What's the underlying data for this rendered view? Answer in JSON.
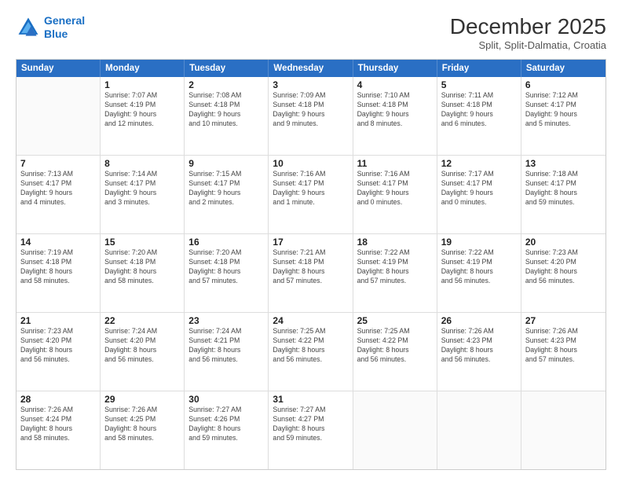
{
  "header": {
    "logo_line1": "General",
    "logo_line2": "Blue",
    "month": "December 2025",
    "location": "Split, Split-Dalmatia, Croatia"
  },
  "days_of_week": [
    "Sunday",
    "Monday",
    "Tuesday",
    "Wednesday",
    "Thursday",
    "Friday",
    "Saturday"
  ],
  "weeks": [
    [
      {
        "day": "",
        "info": ""
      },
      {
        "day": "1",
        "info": "Sunrise: 7:07 AM\nSunset: 4:19 PM\nDaylight: 9 hours\nand 12 minutes."
      },
      {
        "day": "2",
        "info": "Sunrise: 7:08 AM\nSunset: 4:18 PM\nDaylight: 9 hours\nand 10 minutes."
      },
      {
        "day": "3",
        "info": "Sunrise: 7:09 AM\nSunset: 4:18 PM\nDaylight: 9 hours\nand 9 minutes."
      },
      {
        "day": "4",
        "info": "Sunrise: 7:10 AM\nSunset: 4:18 PM\nDaylight: 9 hours\nand 8 minutes."
      },
      {
        "day": "5",
        "info": "Sunrise: 7:11 AM\nSunset: 4:18 PM\nDaylight: 9 hours\nand 6 minutes."
      },
      {
        "day": "6",
        "info": "Sunrise: 7:12 AM\nSunset: 4:17 PM\nDaylight: 9 hours\nand 5 minutes."
      }
    ],
    [
      {
        "day": "7",
        "info": "Sunrise: 7:13 AM\nSunset: 4:17 PM\nDaylight: 9 hours\nand 4 minutes."
      },
      {
        "day": "8",
        "info": "Sunrise: 7:14 AM\nSunset: 4:17 PM\nDaylight: 9 hours\nand 3 minutes."
      },
      {
        "day": "9",
        "info": "Sunrise: 7:15 AM\nSunset: 4:17 PM\nDaylight: 9 hours\nand 2 minutes."
      },
      {
        "day": "10",
        "info": "Sunrise: 7:16 AM\nSunset: 4:17 PM\nDaylight: 9 hours\nand 1 minute."
      },
      {
        "day": "11",
        "info": "Sunrise: 7:16 AM\nSunset: 4:17 PM\nDaylight: 9 hours\nand 0 minutes."
      },
      {
        "day": "12",
        "info": "Sunrise: 7:17 AM\nSunset: 4:17 PM\nDaylight: 9 hours\nand 0 minutes."
      },
      {
        "day": "13",
        "info": "Sunrise: 7:18 AM\nSunset: 4:17 PM\nDaylight: 8 hours\nand 59 minutes."
      }
    ],
    [
      {
        "day": "14",
        "info": "Sunrise: 7:19 AM\nSunset: 4:18 PM\nDaylight: 8 hours\nand 58 minutes."
      },
      {
        "day": "15",
        "info": "Sunrise: 7:20 AM\nSunset: 4:18 PM\nDaylight: 8 hours\nand 58 minutes."
      },
      {
        "day": "16",
        "info": "Sunrise: 7:20 AM\nSunset: 4:18 PM\nDaylight: 8 hours\nand 57 minutes."
      },
      {
        "day": "17",
        "info": "Sunrise: 7:21 AM\nSunset: 4:18 PM\nDaylight: 8 hours\nand 57 minutes."
      },
      {
        "day": "18",
        "info": "Sunrise: 7:22 AM\nSunset: 4:19 PM\nDaylight: 8 hours\nand 57 minutes."
      },
      {
        "day": "19",
        "info": "Sunrise: 7:22 AM\nSunset: 4:19 PM\nDaylight: 8 hours\nand 56 minutes."
      },
      {
        "day": "20",
        "info": "Sunrise: 7:23 AM\nSunset: 4:20 PM\nDaylight: 8 hours\nand 56 minutes."
      }
    ],
    [
      {
        "day": "21",
        "info": "Sunrise: 7:23 AM\nSunset: 4:20 PM\nDaylight: 8 hours\nand 56 minutes."
      },
      {
        "day": "22",
        "info": "Sunrise: 7:24 AM\nSunset: 4:20 PM\nDaylight: 8 hours\nand 56 minutes."
      },
      {
        "day": "23",
        "info": "Sunrise: 7:24 AM\nSunset: 4:21 PM\nDaylight: 8 hours\nand 56 minutes."
      },
      {
        "day": "24",
        "info": "Sunrise: 7:25 AM\nSunset: 4:22 PM\nDaylight: 8 hours\nand 56 minutes."
      },
      {
        "day": "25",
        "info": "Sunrise: 7:25 AM\nSunset: 4:22 PM\nDaylight: 8 hours\nand 56 minutes."
      },
      {
        "day": "26",
        "info": "Sunrise: 7:26 AM\nSunset: 4:23 PM\nDaylight: 8 hours\nand 56 minutes."
      },
      {
        "day": "27",
        "info": "Sunrise: 7:26 AM\nSunset: 4:23 PM\nDaylight: 8 hours\nand 57 minutes."
      }
    ],
    [
      {
        "day": "28",
        "info": "Sunrise: 7:26 AM\nSunset: 4:24 PM\nDaylight: 8 hours\nand 58 minutes."
      },
      {
        "day": "29",
        "info": "Sunrise: 7:26 AM\nSunset: 4:25 PM\nDaylight: 8 hours\nand 58 minutes."
      },
      {
        "day": "30",
        "info": "Sunrise: 7:27 AM\nSunset: 4:26 PM\nDaylight: 8 hours\nand 59 minutes."
      },
      {
        "day": "31",
        "info": "Sunrise: 7:27 AM\nSunset: 4:27 PM\nDaylight: 8 hours\nand 59 minutes."
      },
      {
        "day": "",
        "info": ""
      },
      {
        "day": "",
        "info": ""
      },
      {
        "day": "",
        "info": ""
      }
    ]
  ]
}
